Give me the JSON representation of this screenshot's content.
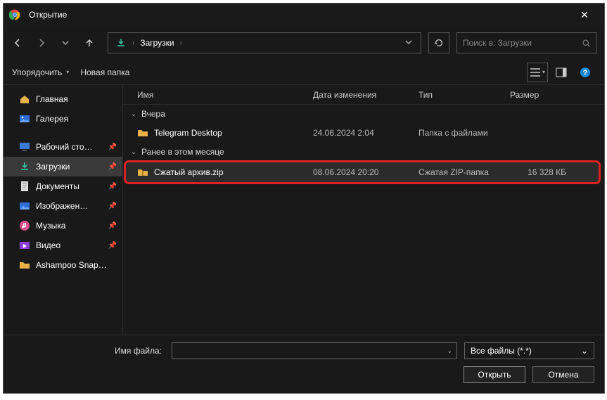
{
  "title": "Открытие",
  "path": {
    "folder": "Загрузки"
  },
  "search": {
    "placeholder": "Поиск в: Загрузки"
  },
  "toolbar": {
    "organize": "Упорядочить",
    "newfolder": "Новая папка"
  },
  "columns": {
    "name": "Имя",
    "date": "Дата изменения",
    "type": "Тип",
    "size": "Размер"
  },
  "sidebar": {
    "main": "Главная",
    "gallery": "Галерея",
    "desktop": "Рабочий сто…",
    "downloads": "Загрузки",
    "documents": "Документы",
    "images": "Изображен…",
    "music": "Музыка",
    "video": "Видео",
    "snap": "Ashampoo Snap…"
  },
  "group1": {
    "label": "Вчера"
  },
  "row1": {
    "name": "Telegram Desktop",
    "date": "24.06.2024 2:04",
    "type": "Папка с файлами",
    "size": ""
  },
  "group2": {
    "label": "Ранее в этом месяце"
  },
  "row2": {
    "name": "Сжатый архив.zip",
    "date": "08.06.2024 20:20",
    "type": "Сжатая ZIP-папка",
    "size": "16 328 КБ"
  },
  "footer": {
    "fn_label": "Имя файла:",
    "filter": "Все файлы (*.*)",
    "open": "Открыть",
    "cancel": "Отмена"
  }
}
